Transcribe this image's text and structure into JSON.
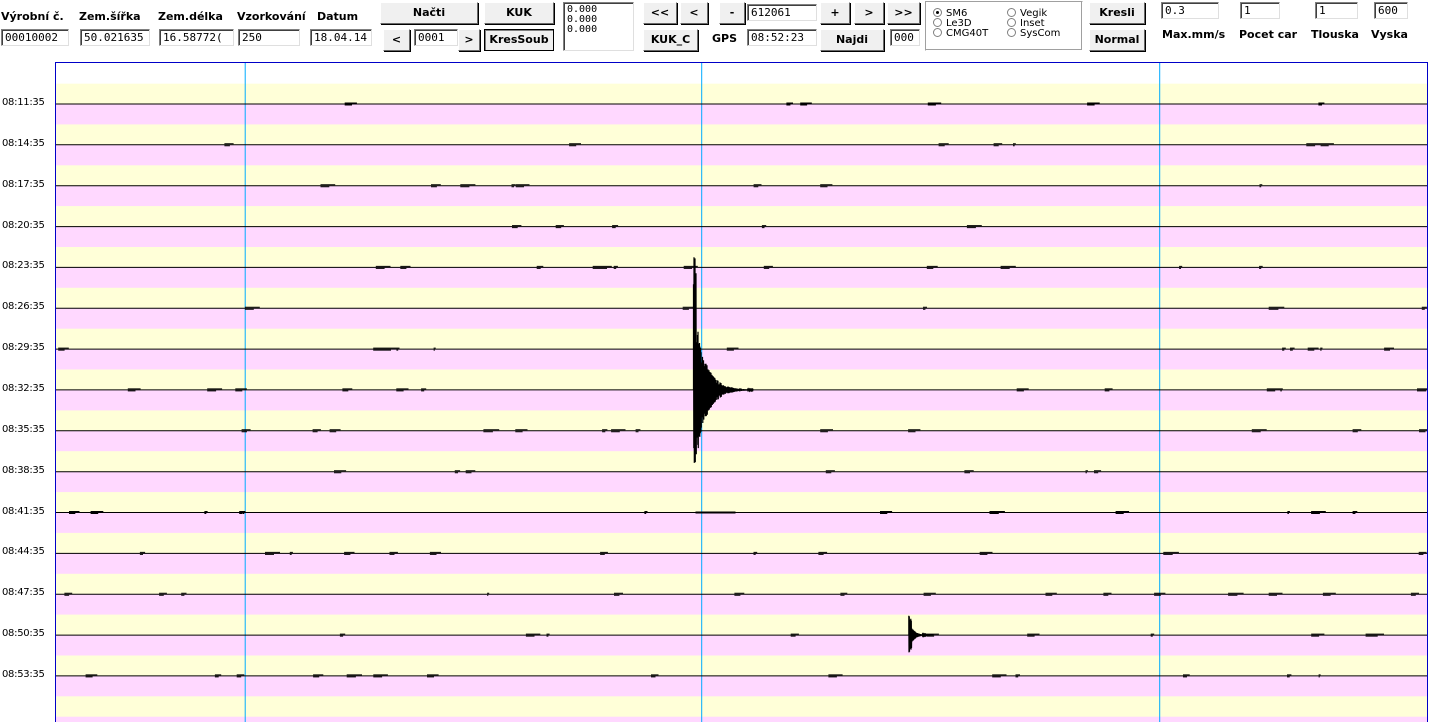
{
  "toolbar": {
    "labels": {
      "serial": "Výrobní č.",
      "lat": "Zem.šířka",
      "lon": "Zem.délka",
      "sampling": "Vzorkování",
      "date": "Datum",
      "maxmm": "Max.mm/s",
      "pocet": "Pocet car",
      "tlouska": "Tlouska",
      "vyska": "Vyska",
      "gps": "GPS"
    },
    "values": {
      "serial": "00010002",
      "lat": "50.021635",
      "lon": "16.58772(",
      "sampling": "250",
      "date": "18.04.14",
      "file_no": "0001",
      "counter": "612061",
      "gps_time": "08:52:23",
      "small": "000",
      "maxmm": "0.3",
      "pocet": "1",
      "tlouska": "1",
      "vyska": "600"
    },
    "memo_lines": [
      "0.000",
      "0.000",
      "0.000"
    ],
    "buttons": {
      "nacti": "Načti",
      "kuk": "KUK",
      "prev_file": "<",
      "next_file": ">",
      "kressoub": "KresSoub",
      "first": "<<",
      "prev": "<",
      "minus": "-",
      "plus": "+",
      "next": ">",
      "last": ">>",
      "kuk_c": "KUK_C",
      "najdi": "Najdi",
      "kresli": "Kresli",
      "normal": "Normal"
    },
    "radios": [
      {
        "label": "SM6",
        "selected": true
      },
      {
        "label": "Le3D",
        "selected": false
      },
      {
        "label": "CMG40T",
        "selected": false
      },
      {
        "label": "Vegik",
        "selected": false
      },
      {
        "label": "Inset",
        "selected": false
      },
      {
        "label": "SysCom",
        "selected": false
      }
    ]
  },
  "chart_data": {
    "type": "line",
    "title": "",
    "xlabel": "",
    "ylabel": "",
    "time_labels": [
      "08:11:35",
      "08:14:35",
      "08:17:35",
      "08:20:35",
      "08:23:35",
      "08:26:35",
      "08:29:35",
      "08:32:35",
      "08:35:35",
      "08:38:35",
      "08:41:35",
      "08:44:35",
      "08:47:35",
      "08:50:35",
      "08:53:35"
    ],
    "band_colors": [
      "#ffffd8",
      "#ffd8ff"
    ],
    "axis_color": "#0000c8",
    "marker_color": "#00aaff",
    "trace_color": "#000000",
    "vertical_marker_fractions": [
      0.138,
      0.471,
      0.805
    ],
    "events": [
      {
        "label": "08:32:35",
        "x_fraction": 0.465,
        "amplitude_rows": 4.0
      },
      {
        "label": "08:50:35",
        "x_fraction": 0.622,
        "amplitude_rows": 0.65
      }
    ]
  }
}
